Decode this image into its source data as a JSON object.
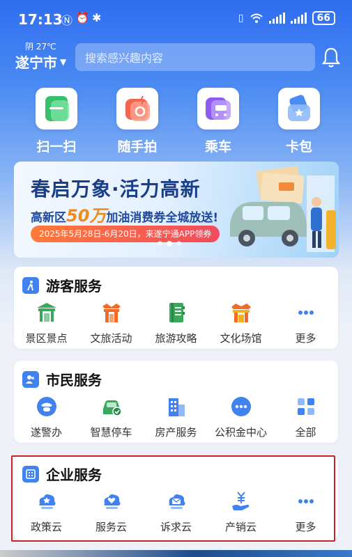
{
  "status": {
    "time": "17:13",
    "battery": "66"
  },
  "header": {
    "weather": "阴 27℃",
    "city": "遂宁市",
    "search_placeholder": "搜索感兴趣内容"
  },
  "quick_actions": [
    {
      "label": "扫一扫",
      "icon": "scan-icon"
    },
    {
      "label": "随手拍",
      "icon": "camera-icon"
    },
    {
      "label": "乘车",
      "icon": "bus-icon"
    },
    {
      "label": "卡包",
      "icon": "card-wallet-icon"
    }
  ],
  "banner": {
    "title": "春启万象·活力高新",
    "subtitle_pre": "高新区",
    "subtitle_highlight": "50万",
    "subtitle_post": "加油消费券全城放送!",
    "date_text": "2025年5月28日-6月20日，来遂宁通APP领券"
  },
  "tourist": {
    "title": "游客服务",
    "items": [
      {
        "label": "景区景点",
        "icon": "scenic-spot-icon"
      },
      {
        "label": "文旅活动",
        "icon": "culture-activity-icon"
      },
      {
        "label": "旅游攻略",
        "icon": "travel-guide-icon"
      },
      {
        "label": "文化场馆",
        "icon": "culture-venue-icon"
      },
      {
        "label": "更多",
        "icon": "more-icon"
      }
    ]
  },
  "citizen": {
    "title": "市民服务",
    "items": [
      {
        "label": "遂警办",
        "icon": "police-icon"
      },
      {
        "label": "智慧停车",
        "icon": "parking-icon"
      },
      {
        "label": "房产服务",
        "icon": "building-icon"
      },
      {
        "label": "公积金中心",
        "icon": "fund-center-icon"
      },
      {
        "label": "全部",
        "icon": "grid-icon"
      }
    ]
  },
  "enterprise": {
    "title": "企业服务",
    "items": [
      {
        "label": "政策云",
        "icon": "policy-cloud-icon"
      },
      {
        "label": "服务云",
        "icon": "service-cloud-icon"
      },
      {
        "label": "诉求云",
        "icon": "appeal-cloud-icon"
      },
      {
        "label": "产销云",
        "icon": "sales-cloud-icon"
      },
      {
        "label": "更多",
        "icon": "more-icon"
      }
    ]
  },
  "colors": {
    "primary": "#3f82f0",
    "orange": "#f26a28",
    "green": "#3aa85a",
    "highlight_border": "#c8222c"
  }
}
